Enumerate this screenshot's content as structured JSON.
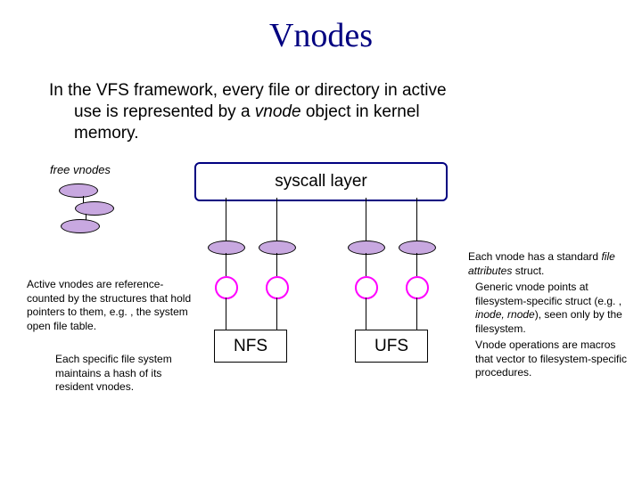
{
  "title": "Vnodes",
  "intro_line1": "In the VFS framework, every file or directory in active",
  "intro_line2_a": "use is represented by a ",
  "intro_line2_em": "vnode",
  "intro_line2_b": " object in kernel",
  "intro_line3": "memory.",
  "free_label": "free vnodes",
  "syscall_label": "syscall layer",
  "fs": {
    "nfs": "NFS",
    "ufs": "UFS"
  },
  "notes": {
    "attrs_a": "Each vnode has a standard ",
    "attrs_em": "file attributes",
    "attrs_b": " struct.",
    "active": "Active vnodes are reference-counted by the structures that hold pointers to them, e.g. , the system open file table.",
    "each_fs": "Each specific file system maintains a hash of its resident vnodes.",
    "generic_a": "Generic vnode points at filesystem-specific struct (e.g. , ",
    "generic_em": "inode, rnode",
    "generic_b": "), seen only by the filesystem.",
    "ops": "Vnode operations are macros that vector to filesystem-specific procedures."
  }
}
